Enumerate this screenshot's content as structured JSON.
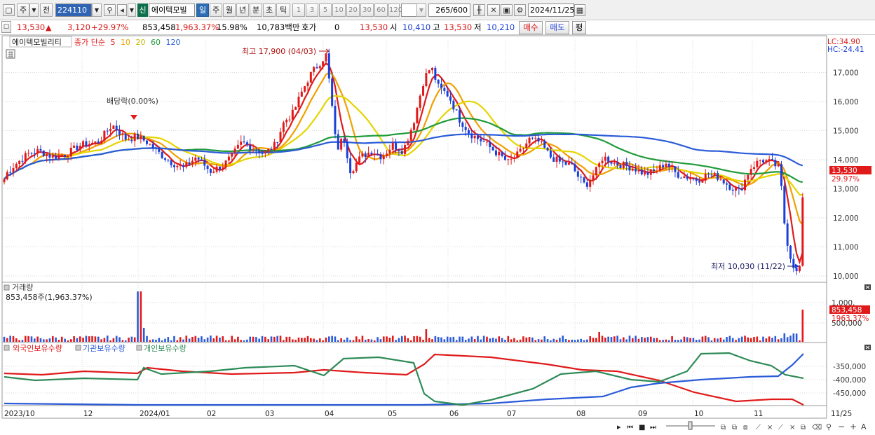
{
  "toolbar": {
    "period_mode": "주",
    "prev_label": "전",
    "code": "224110",
    "new_badge": "신",
    "stock_name": "에이텍모빌",
    "periods": [
      "일",
      "주",
      "월",
      "년",
      "분",
      "초",
      "틱"
    ],
    "selected_period": "일",
    "intervals": [
      "1",
      "3",
      "5",
      "10",
      "20",
      "30",
      "60",
      "120"
    ],
    "count_display": "265",
    "count_total": "/600",
    "date": "2024/11/25"
  },
  "quote": {
    "price": "13,530",
    "change": "3,120",
    "change_pct": "+29.97%",
    "volume": "853,458",
    "volume_pct": "1,963.37%",
    "turnover_pct": "15.98%",
    "amount": "10,783백만",
    "hoga_label": "호가",
    "hoga_value": "0",
    "hoga_price": "13,530",
    "open_label": "시",
    "open": "10,410",
    "high_label": "고",
    "high": "13,530",
    "low_label": "저",
    "low": "10,210",
    "buy_label": "매수",
    "sell_label": "매도",
    "eval_label": "평"
  },
  "price_panel": {
    "stock_name": "에이텍모빌리티",
    "ma_title": "종가 단순",
    "ma_periods": [
      "5",
      "10",
      "20",
      "60",
      "120"
    ],
    "ma_colors": [
      "#e01a1a",
      "#f0a000",
      "#e5d500",
      "#1f9a3a",
      "#2b5bd8"
    ],
    "lc_label": "LC:34.90",
    "hc_label": "HC:-24.41",
    "current_price_tag": "13,530",
    "current_pct_tag": "29.97%",
    "high_note": "최고 17,900 (04/03)",
    "low_note": "최저 10,030 (11/22)",
    "dividend_note": "배당락(0.00%)"
  },
  "volume_panel": {
    "title": "거래량",
    "value_line": "853,458주(1,963.37%)",
    "current_tag": "853,458",
    "current_pct_tag": "1963.37%"
  },
  "holding_panel": {
    "series_labels": [
      "외국인보유수량",
      "기관보유수량",
      "개인보유수량"
    ],
    "series_colors": [
      "#e01a1a",
      "#2b5bd8",
      "#2e8b57"
    ]
  },
  "x_axis": {
    "ticks": [
      "2023/10",
      "12",
      "2024/01",
      "02",
      "03",
      "04",
      "05",
      "06",
      "07",
      "08",
      "09",
      "10",
      "11",
      "11/25"
    ]
  },
  "chart_data": [
    {
      "type": "candlestick",
      "title": "에이텍모빌리티",
      "y_ticks": [
        "17,000",
        "16,000",
        "15,000",
        "14,000",
        "13,000",
        "12,000",
        "11,000",
        "10,000"
      ],
      "ylim": [
        9950,
        17900
      ],
      "annotations": [
        "최고 17,900 (04/03)",
        "최저 10,030 (11/22)",
        "배당락(0.00%)"
      ],
      "last": {
        "price": 13530,
        "open": 10410,
        "high": 13530,
        "low": 10210
      }
    },
    {
      "type": "bar",
      "title": "거래량",
      "y_ticks": [
        "1,000,",
        "500,000"
      ],
      "last": 853458
    },
    {
      "type": "line",
      "series_names": [
        "외국인보유수량",
        "기관보유수량",
        "개인보유수량"
      ],
      "y_ticks": [
        "-350,000",
        "-400,000",
        "-450,000"
      ]
    }
  ]
}
